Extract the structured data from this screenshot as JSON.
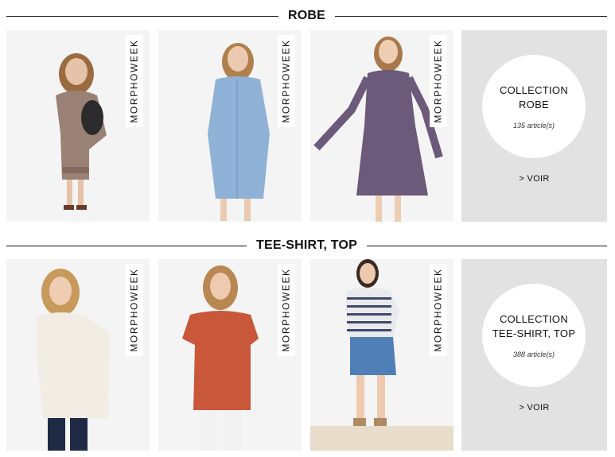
{
  "sections": [
    {
      "title": "ROBE",
      "products": [
        {
          "tag": "MORPHOWEEK",
          "dress": "#9a8176",
          "skin": "#e6c2a8",
          "hair": "#9a6a40",
          "pattern": "#7a5f5a"
        },
        {
          "tag": "MORPHOWEEK",
          "dress": "#8fb2d6",
          "skin": "#eccab0",
          "hair": "#b0804c",
          "pattern": "#7ea3c8"
        },
        {
          "tag": "MORPHOWEEK",
          "dress": "#6b5a7a",
          "skin": "#efcdb2",
          "hair": "#a8784c",
          "pattern": "#8a6e8a"
        }
      ],
      "collection": {
        "title": "COLLECTION ROBE",
        "count": "135 article(s)",
        "link": "> VOIR"
      }
    },
    {
      "title": "TEE-SHIRT, TOP",
      "products": [
        {
          "tag": "MORPHOWEEK",
          "dress": "#f1ede4",
          "skin": "#eecdb3",
          "hair": "#c79a5c",
          "pants": "#1f2b44"
        },
        {
          "tag": "MORPHOWEEK",
          "dress": "#c9573a",
          "skin": "#eecbb0",
          "hair": "#b88752",
          "pants": "#f2f2f2"
        },
        {
          "tag": "MORPHOWEEK",
          "dress": "#e9e9ee",
          "skin": "#efc9ae",
          "hair": "#3a2a22",
          "pants": "#4f7fb6"
        }
      ],
      "collection": {
        "title": "COLLECTION TEE-SHIRT, TOP",
        "count": "388 article(s)",
        "link": "> VOIR"
      }
    }
  ]
}
